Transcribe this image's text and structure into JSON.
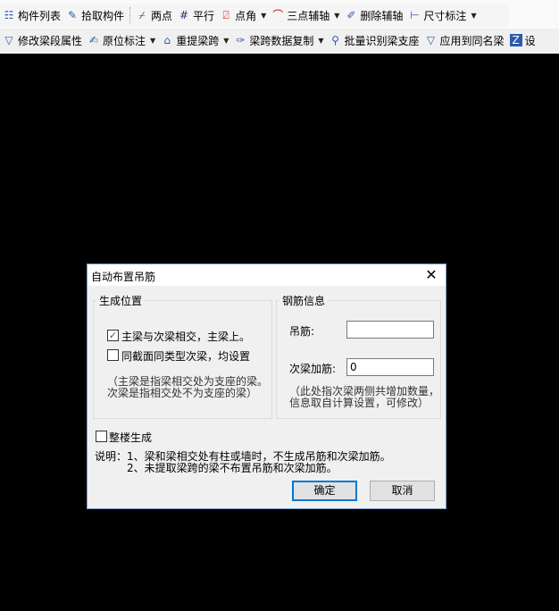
{
  "toolbar1": [
    {
      "label": "构件列表",
      "icon": "list-icon"
    },
    {
      "label": "拾取构件",
      "icon": "pick-icon"
    },
    {
      "label": "两点",
      "icon": "two-point-axis-icon"
    },
    {
      "label": "平行",
      "icon": "parallel-axis-icon"
    },
    {
      "label": "点角",
      "icon": "point-angle-icon",
      "dropdown": true
    },
    {
      "label": "三点辅轴",
      "icon": "three-point-arc-icon",
      "dropdown": true
    },
    {
      "label": "删除辅轴",
      "icon": "eraser-icon"
    },
    {
      "label": "尺寸标注",
      "icon": "dimension-icon",
      "dropdown": true
    }
  ],
  "toolbar2": [
    {
      "label": "修改梁段属性",
      "icon": "edit-attribute-icon"
    },
    {
      "label": "原位标注",
      "icon": "in-place-annotation-icon",
      "dropdown": true
    },
    {
      "label": "重提梁跨",
      "icon": "beam-span-icon",
      "dropdown": true
    },
    {
      "label": "梁跨数据复制",
      "icon": "brush-copy-icon",
      "dropdown": true
    },
    {
      "label": "批量识别梁支座",
      "icon": "identify-support-icon"
    },
    {
      "label": "应用到同名梁",
      "icon": "apply-same-name-icon"
    },
    {
      "label": "设",
      "icon": "settings-icon"
    }
  ],
  "dialog": {
    "title": "自动布置吊筋",
    "group_position": {
      "title": "生成位置",
      "opt1": {
        "label": "主梁与次梁相交，主梁上。",
        "checked": true
      },
      "opt2": {
        "label": "同截面同类型次梁，均设置",
        "checked": false
      },
      "note1": "（主梁是指梁相交处为支座的梁。",
      "note2": "次梁是指相交处不为支座的梁）"
    },
    "group_rebar": {
      "title": "钢筋信息",
      "hanger_label": "吊筋:",
      "hanger_value": "",
      "secondary_label": "次梁加筋:",
      "secondary_value": "0",
      "note1": "（此处指次梁两侧共增加数量，",
      "note2": "信息取自计算设置，可修改）"
    },
    "whole_building": {
      "label": "整楼生成",
      "checked": false
    },
    "desc1": "说明：1、梁和梁相交处有柱或墙时，不生成吊筋和次梁加筋。",
    "desc2": "2、未提取梁跨的梁不布置吊筋和次梁加筋。",
    "ok": "确定",
    "cancel": "取消"
  }
}
